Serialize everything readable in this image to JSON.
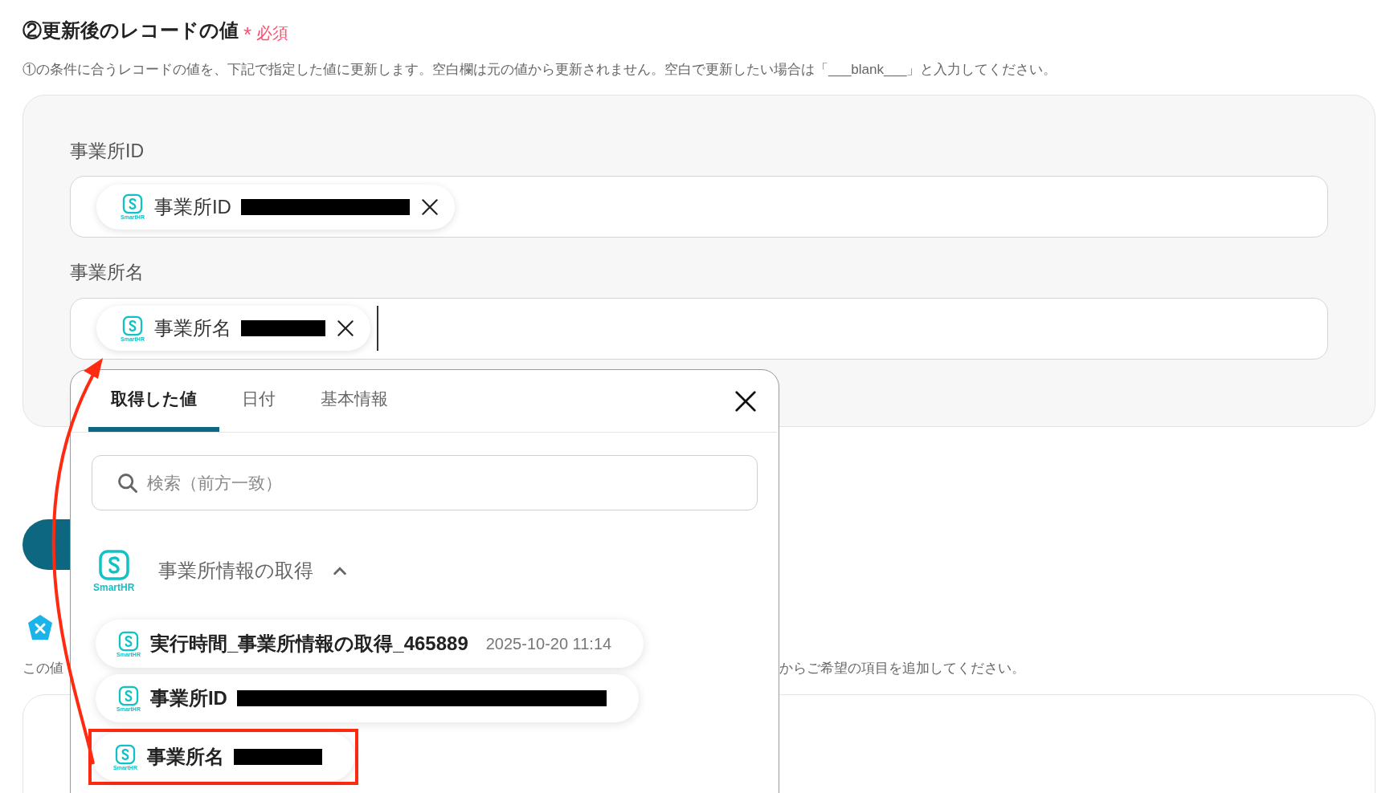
{
  "section": {
    "title": "②更新後のレコードの値",
    "required_mark": "*",
    "required_label": "必須",
    "description": "①の条件に合うレコードの値を、下記で指定した値に更新します。空白欄は元の値から更新されません。空白で更新したい場合は「___blank___」と入力してください。"
  },
  "fields": [
    {
      "label": "事業所ID",
      "token": {
        "app": "SmartHR",
        "name": "事業所ID",
        "kind": "redacted"
      },
      "cursor": false
    },
    {
      "label": "事業所名",
      "token": {
        "app": "SmartHR",
        "name": "事業所名",
        "kind": "redacted"
      },
      "cursor": true
    }
  ],
  "behind": {
    "sentence_start": "この値",
    "sentence_end": "からご希望の項目を追加してください。"
  },
  "picker": {
    "tabs": [
      {
        "label": "取得した値",
        "selected": true
      },
      {
        "label": "日付",
        "selected": false
      },
      {
        "label": "基本情報",
        "selected": false
      }
    ],
    "search": {
      "placeholder": "検索（前方一致）"
    },
    "group": {
      "app": "SmartHR",
      "title": "事業所情報の取得",
      "expanded": true
    },
    "items": [
      {
        "app": "SmartHR",
        "name": "実行時間_事業所情報の取得_465889",
        "kind": "text",
        "value": "2025-10-20 11:14",
        "highlighted": false
      },
      {
        "app": "SmartHR",
        "name": "事業所ID",
        "kind": "redacted",
        "highlighted": false
      },
      {
        "app": "SmartHR",
        "name": "事業所名",
        "kind": "redacted",
        "highlighted": true
      }
    ]
  }
}
